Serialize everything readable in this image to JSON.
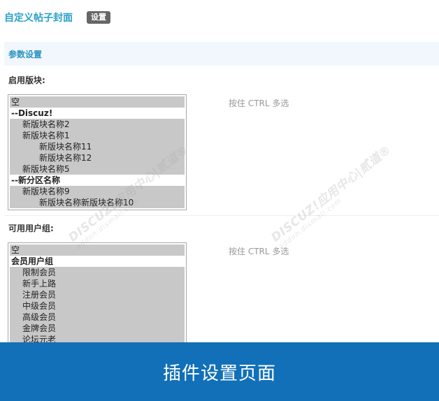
{
  "header": {
    "title": "自定义帖子封面",
    "settings_label": "设置"
  },
  "section": {
    "title": "参数设置"
  },
  "forums_field": {
    "label": "启用版块:",
    "hint": "按住 CTRL 多选",
    "options": [
      {
        "text": "空",
        "kind": "option",
        "level": 0
      },
      {
        "text": "--Discuz!",
        "kind": "group",
        "level": 0
      },
      {
        "text": "新版块名称2",
        "kind": "option",
        "level": 1
      },
      {
        "text": "新版块名称1",
        "kind": "option",
        "level": 1
      },
      {
        "text": "新版块名称11",
        "kind": "option",
        "level": 2
      },
      {
        "text": "新版块名称12",
        "kind": "option",
        "level": 2
      },
      {
        "text": "新版块名称5",
        "kind": "option",
        "level": 1
      },
      {
        "text": "--新分区名称",
        "kind": "group",
        "level": 0
      },
      {
        "text": "新版块名称9",
        "kind": "option",
        "level": 1
      },
      {
        "text": "新版块名称新版块名称10",
        "kind": "option",
        "level": 2
      }
    ]
  },
  "groups_field": {
    "label": "可用用户组:",
    "hint": "按住 CTRL 多选",
    "options": [
      {
        "text": "空",
        "kind": "option",
        "level": 0
      },
      {
        "text": "会员用户组",
        "kind": "group",
        "level": 0
      },
      {
        "text": "限制会员",
        "kind": "option",
        "level": 1
      },
      {
        "text": "新手上路",
        "kind": "option",
        "level": 1
      },
      {
        "text": "注册会员",
        "kind": "option",
        "level": 1
      },
      {
        "text": "中级会员",
        "kind": "option",
        "level": 1
      },
      {
        "text": "高级会员",
        "kind": "option",
        "level": 1
      },
      {
        "text": "金牌会员",
        "kind": "option",
        "level": 1
      },
      {
        "text": "论坛元老",
        "kind": "option",
        "level": 1
      }
    ]
  },
  "watermark": {
    "brand": "DISCUZ!应用中心|贰道®",
    "url": "addon.dismall.com"
  },
  "banner": {
    "text": "插件设置页面"
  },
  "colors": {
    "accent": "#2aa1c8",
    "banner": "#1170b8",
    "selected_option": "#c8c8c8"
  }
}
